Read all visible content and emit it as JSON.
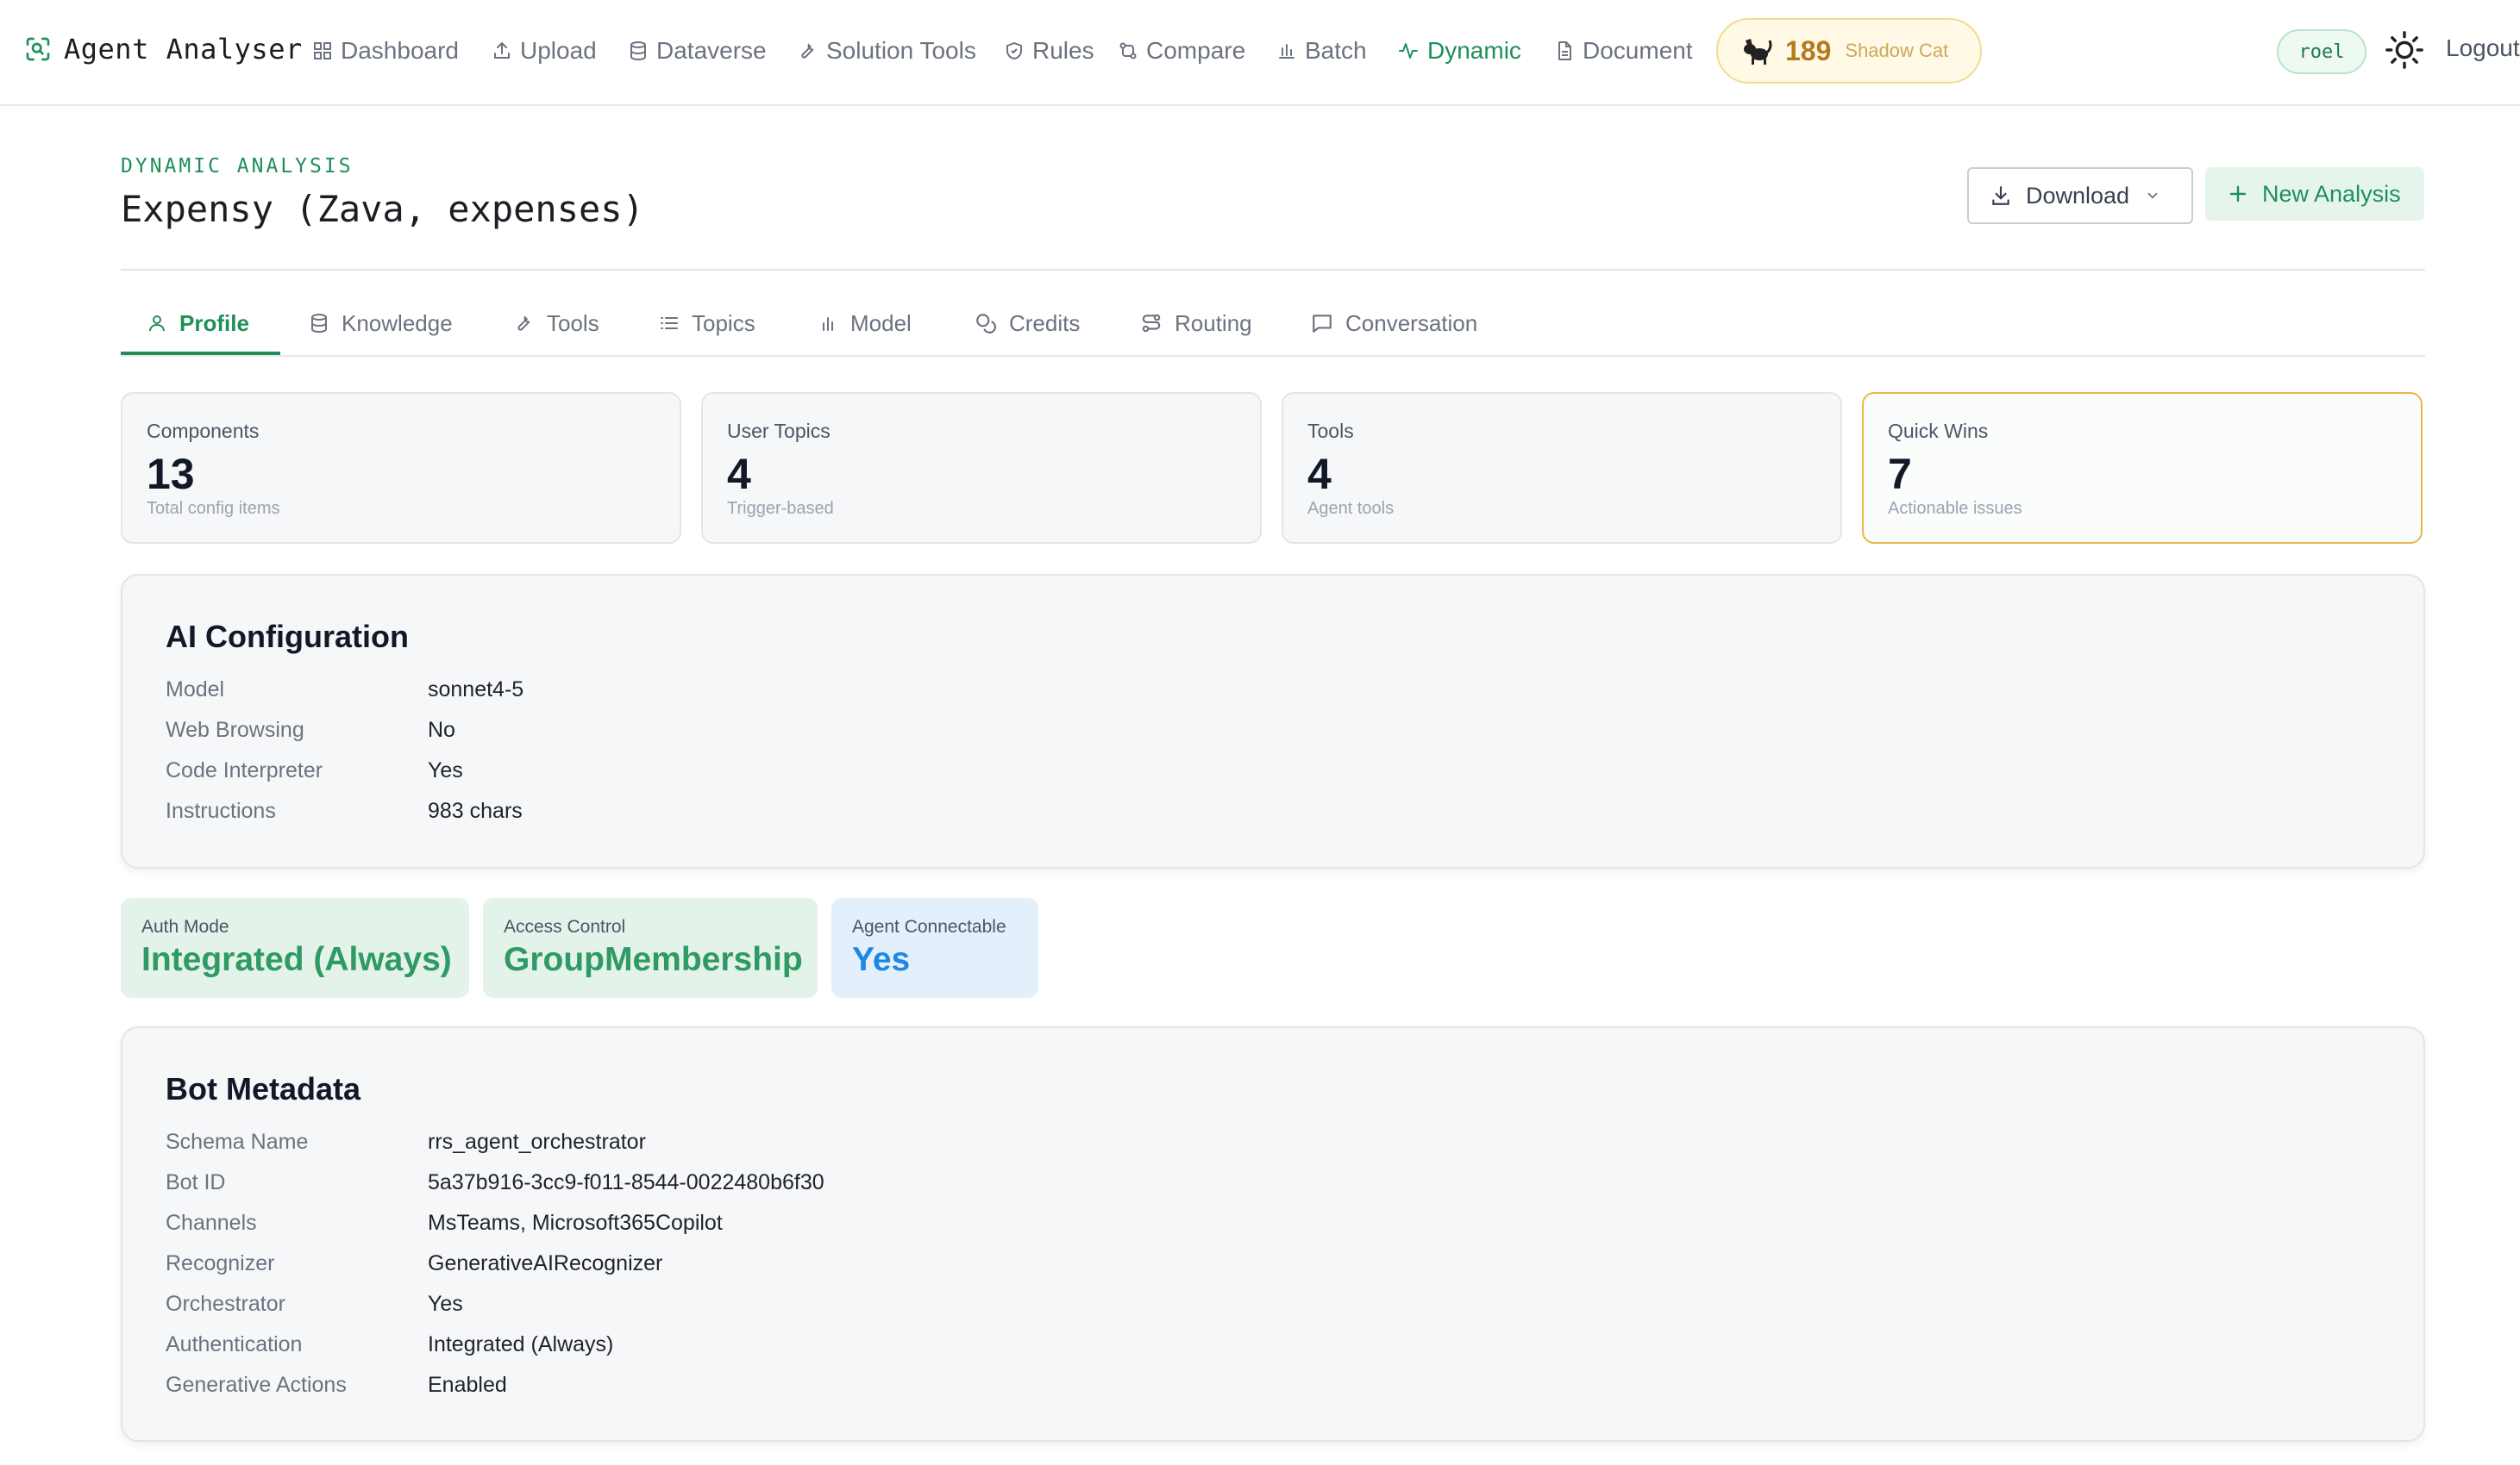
{
  "app": {
    "title": "Agent Analyser"
  },
  "nav": {
    "items": [
      {
        "label": "Dashboard",
        "icon": "dashboard-icon"
      },
      {
        "label": "Upload",
        "icon": "upload-icon"
      },
      {
        "label": "Dataverse",
        "icon": "database-icon"
      },
      {
        "label": "Solution Tools",
        "icon": "wrench-icon"
      },
      {
        "label": "Rules",
        "icon": "shield-icon"
      },
      {
        "label": "Compare",
        "icon": "compare-icon"
      },
      {
        "label": "Batch",
        "icon": "bar-chart-icon"
      },
      {
        "label": "Dynamic",
        "icon": "activity-icon",
        "active": true
      },
      {
        "label": "Document",
        "icon": "document-icon"
      }
    ],
    "score": {
      "value": "189",
      "name": "Shadow Cat",
      "icon": "cat-icon"
    },
    "user": "roel",
    "theme_icon": "sun-icon",
    "logout": "Logout"
  },
  "header": {
    "eyebrow": "DYNAMIC ANALYSIS",
    "title": "Expensy (Zava, expenses)",
    "download": "Download",
    "new_analysis": "New Analysis"
  },
  "tabs": [
    {
      "label": "Profile",
      "icon": "user-icon",
      "active": true
    },
    {
      "label": "Knowledge",
      "icon": "database-icon"
    },
    {
      "label": "Tools",
      "icon": "wrench-icon"
    },
    {
      "label": "Topics",
      "icon": "list-icon"
    },
    {
      "label": "Model",
      "icon": "bar-chart-icon"
    },
    {
      "label": "Credits",
      "icon": "coins-icon"
    },
    {
      "label": "Routing",
      "icon": "route-icon"
    },
    {
      "label": "Conversation",
      "icon": "message-icon"
    }
  ],
  "stats": [
    {
      "label": "Components",
      "value": "13",
      "sub": "Total config items"
    },
    {
      "label": "User Topics",
      "value": "4",
      "sub": "Trigger-based"
    },
    {
      "label": "Tools",
      "value": "4",
      "sub": "Agent tools"
    },
    {
      "label": "Quick Wins",
      "value": "7",
      "sub": "Actionable issues",
      "highlight_color": "#e9b949"
    }
  ],
  "ai_config": {
    "title": "AI Configuration",
    "rows": [
      {
        "key": "Model",
        "value": "sonnet4-5"
      },
      {
        "key": "Web Browsing",
        "value": "No"
      },
      {
        "key": "Code Interpreter",
        "value": "Yes"
      },
      {
        "key": "Instructions",
        "value": "983 chars"
      }
    ]
  },
  "auth": [
    {
      "label": "Auth Mode",
      "value": "Integrated (Always)",
      "color": "#2f9a63"
    },
    {
      "label": "Access Control",
      "value": "GroupMembership",
      "color": "#2f9a63"
    },
    {
      "label": "Agent Connectable",
      "value": "Yes",
      "color": "#1e88e5"
    }
  ],
  "bot_metadata": {
    "title": "Bot Metadata",
    "rows": [
      {
        "key": "Schema Name",
        "value": "rrs_agent_orchestrator"
      },
      {
        "key": "Bot ID",
        "value": "5a37b916-3cc9-f011-8544-0022480b6f30"
      },
      {
        "key": "Channels",
        "value": "MsTeams, Microsoft365Copilot"
      },
      {
        "key": "Recognizer",
        "value": "GenerativeAIRecognizer"
      },
      {
        "key": "Orchestrator",
        "value": "Yes"
      },
      {
        "key": "Authentication",
        "value": "Integrated (Always)"
      },
      {
        "key": "Generative Actions",
        "value": "Enabled"
      }
    ]
  },
  "colors": {
    "accent": "#1f8f5a",
    "warning": "#e9b949",
    "info": "#1e88e5"
  }
}
